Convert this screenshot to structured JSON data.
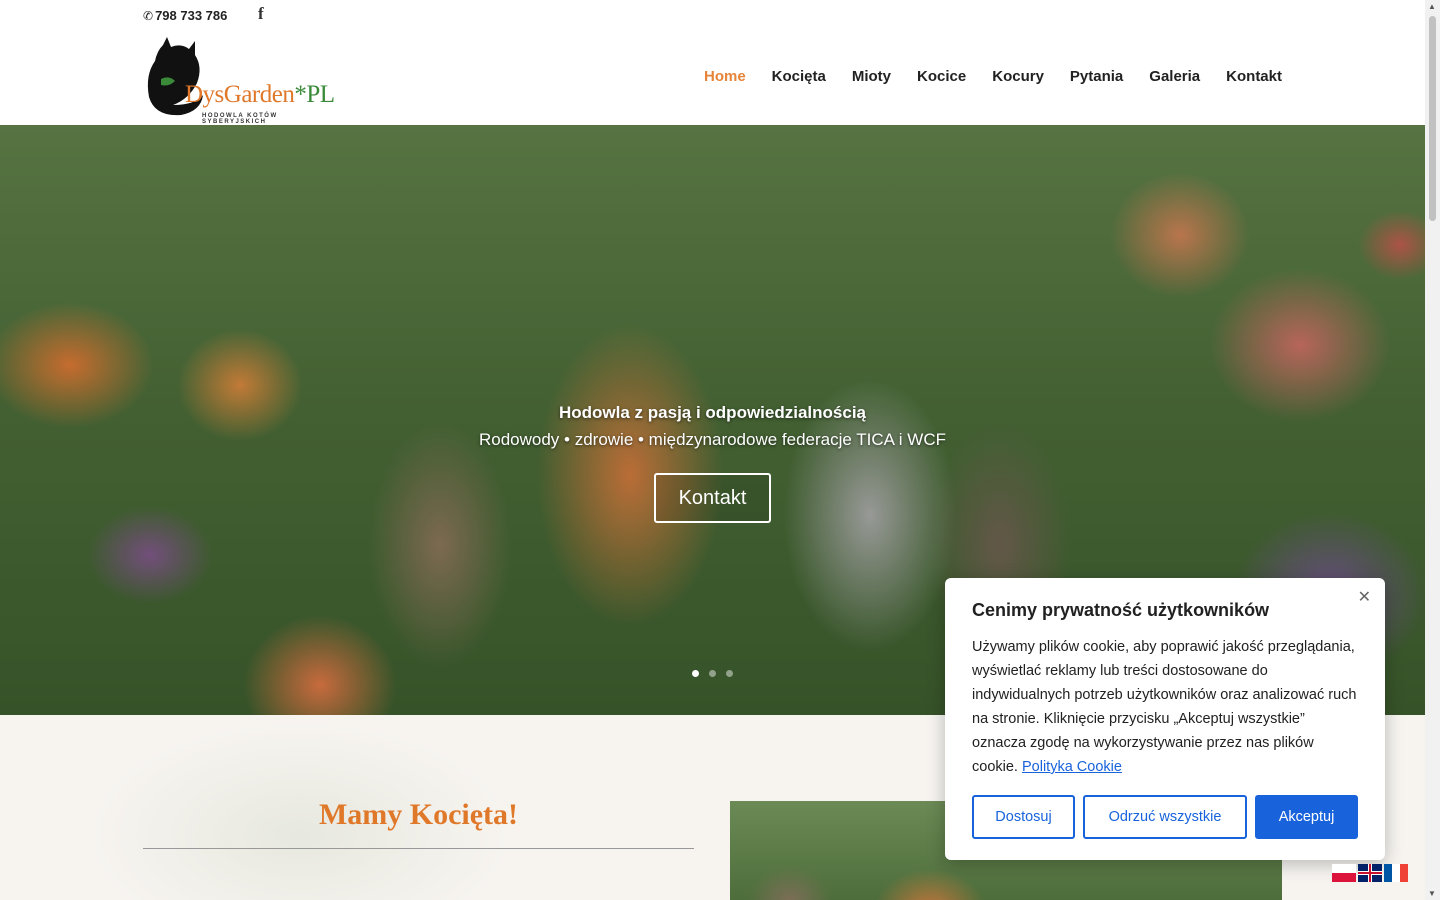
{
  "topbar": {
    "phone": "798 733 786",
    "phone_icon": "phone-icon",
    "social_icon": "facebook-icon"
  },
  "header": {
    "logo_brand": "DysGarden",
    "logo_brand_suffix": "*PL",
    "logo_subtitle": "HODOWLA KOTÓW SYBERYJSKICH",
    "nav": [
      {
        "label": "Home",
        "active": true
      },
      {
        "label": "Kocięta"
      },
      {
        "label": "Mioty"
      },
      {
        "label": "Kocice"
      },
      {
        "label": "Kocury"
      },
      {
        "label": "Pytania"
      },
      {
        "label": "Galeria"
      },
      {
        "label": "Kontakt"
      }
    ]
  },
  "hero": {
    "title": "Hodowla z pasją i odpowiedzialnością",
    "subtitle": "Rodowody • zdrowie • międzynarodowe federacje TICA i WCF",
    "button": "Kontakt",
    "slides_total": 3,
    "slide_active": 1
  },
  "section": {
    "title": "Mamy Kocięta!"
  },
  "cookie": {
    "title": "Cenimy prywatność użytkowników",
    "text": "Używamy plików cookie, aby poprawić jakość przeglądania, wyświetlać reklamy lub treści dostosowane do indywidualnych potrzeb użytkowników oraz analizować ruch na stronie. Kliknięcie przycisku „Akceptuj wszystkie” oznacza zgodę na wykorzystywanie przez nas plików cookie.",
    "link": "Polityka Cookie",
    "btn_customize": "Dostosuj",
    "btn_reject": "Odrzuć wszystkie",
    "btn_accept": "Akceptuj",
    "close_icon": "close-icon"
  },
  "flags": [
    "pl",
    "en",
    "fr"
  ],
  "colors": {
    "accent": "#e6853a",
    "cookie_blue": "#1863dc"
  }
}
